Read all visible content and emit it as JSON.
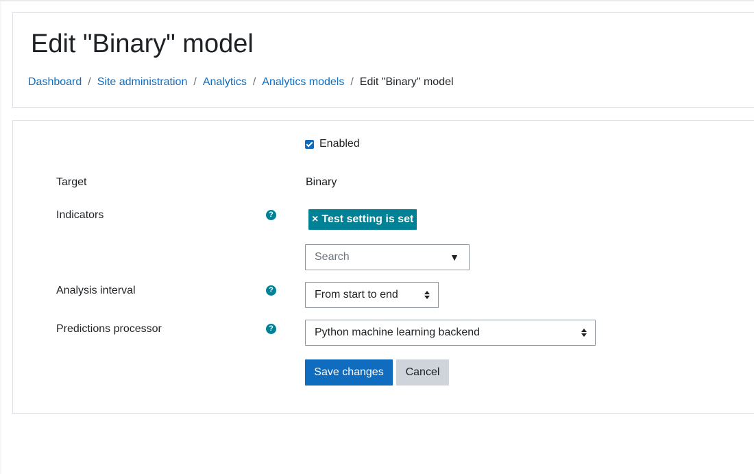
{
  "header": {
    "title": "Edit \"Binary\" model",
    "breadcrumb": [
      {
        "label": "Dashboard"
      },
      {
        "label": "Site administration"
      },
      {
        "label": "Analytics"
      },
      {
        "label": "Analytics models"
      },
      {
        "label": "Edit \"Binary\" model"
      }
    ],
    "breadcrumb_separator": "/"
  },
  "form": {
    "enabled": {
      "label": "Enabled",
      "checked": true
    },
    "target": {
      "label": "Target",
      "value": "Binary"
    },
    "indicators": {
      "label": "Indicators",
      "selected": [
        {
          "remove": "×",
          "label": "Test setting is set"
        }
      ],
      "search_placeholder": "Search",
      "dropdown_glyph": "▼"
    },
    "analysis_interval": {
      "label": "Analysis interval",
      "value": "From start to end"
    },
    "predictions_processor": {
      "label": "Predictions processor",
      "value": "Python machine learning backend"
    },
    "help_glyph": "?",
    "buttons": {
      "save": "Save changes",
      "cancel": "Cancel"
    }
  },
  "colors": {
    "link": "#0f6cbf",
    "primary_button": "#0f6cbf",
    "tag": "#008196",
    "help_icon": "#008196",
    "secondary_button": "#ced4da"
  },
  "icons": [
    "help-icon",
    "checkbox-checked-icon",
    "close-icon",
    "caret-down-icon",
    "select-updown-icon"
  ]
}
